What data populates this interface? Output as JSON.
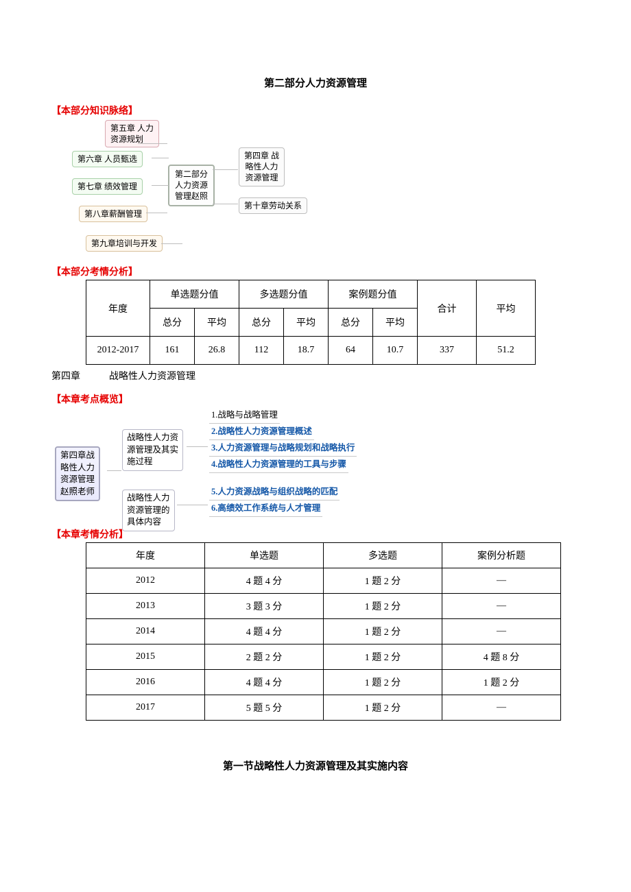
{
  "title": "第二部分人力资源管理",
  "h_knowledge": "【本部分知识脉络】",
  "mind1": {
    "c5": "第五章 人力\n资源规划",
    "c6": "第六章 人员甄选",
    "c7": "第七章 绩效管理",
    "c8": "第八章薪酬管理",
    "c9": "第九章培训与开发",
    "center": "第二部分\n人力资源\n管理赵照",
    "c4": "第四章 战\n略性人力\n资源管理",
    "c10": "第十章劳动关系"
  },
  "h_exam1": "【本部分考情分析】",
  "t1": {
    "year": "年度",
    "single": "单选题分值",
    "multi": "多选题分值",
    "case": "案例题分值",
    "sum": "合计",
    "avg": "平均",
    "total": "总分",
    "row": {
      "year": "2012-2017",
      "s_t": "161",
      "s_a": "26.8",
      "m_t": "112",
      "m_a": "18.7",
      "c_t": "64",
      "c_a": "10.7",
      "sum": "337",
      "avg": "51.2"
    }
  },
  "chapter4": "第四章　　　战略性人力资源管理",
  "h_point": "【本章考点概览】",
  "mind2": {
    "root": "第四章战\n略性人力\n资源管理\n赵照老师",
    "mid1": "战略性人力资\n源管理及其实\n施过程",
    "mid2": "战略性人力\n资源管理的\n具体内容",
    "l1": "1.战略与战略管理",
    "l2": "2.战略性人力资源管理概述",
    "l3": "3.人力资源管理与战略规划和战略执行",
    "l4": "4.战略性人力资源管理的工具与步骤",
    "l5": "5.人力资源战略与组织战略的匹配",
    "l6": "6.高绩效工作系统与人才管理"
  },
  "h_exam2": "【本章考情分析】",
  "t2": {
    "h_year": "年度",
    "h_s": "单选题",
    "h_m": "多选题",
    "h_c": "案例分析题",
    "rows": [
      {
        "y": "2012",
        "s": "4 题 4 分",
        "m": "1 题 2 分",
        "c": "—"
      },
      {
        "y": "2013",
        "s": "3 题 3 分",
        "m": "1 题 2 分",
        "c": "—"
      },
      {
        "y": "2014",
        "s": "4 题 4 分",
        "m": "1 题 2 分",
        "c": "—"
      },
      {
        "y": "2015",
        "s": "2 题 2 分",
        "m": "1 题 2 分",
        "c": "4 题 8 分"
      },
      {
        "y": "2016",
        "s": "4 题 4 分",
        "m": "1 题 2 分",
        "c": "1 题 2 分"
      },
      {
        "y": "2017",
        "s": "5 题 5 分",
        "m": "1 题 2 分",
        "c": "—"
      }
    ]
  },
  "section1": "第一节战略性人力资源管理及其实施内容"
}
